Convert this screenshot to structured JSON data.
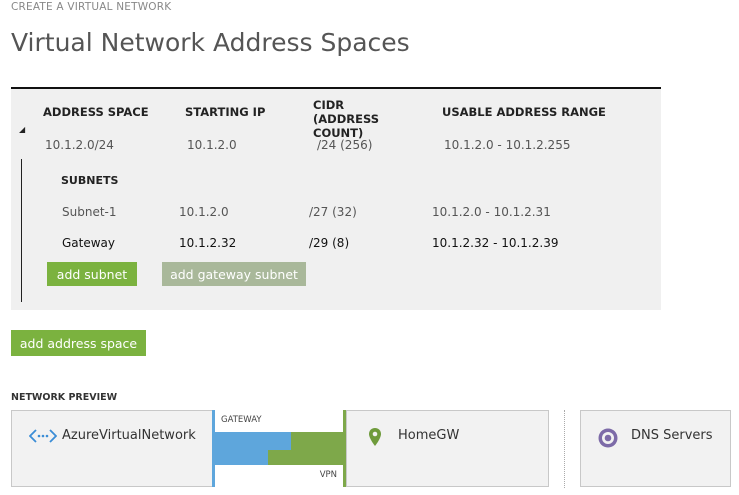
{
  "breadcrumb": "CREATE A VIRTUAL NETWORK",
  "page_title": "Virtual Network Address Spaces",
  "table": {
    "headers": {
      "address_space": "ADDRESS SPACE",
      "starting_ip": "STARTING IP",
      "cidr": "CIDR (ADDRESS COUNT)",
      "usable_range": "USABLE ADDRESS RANGE"
    },
    "address_space_row": {
      "address_space": "10.1.2.0/24",
      "starting_ip": "10.1.2.0",
      "cidr": "/24 (256)",
      "usable_range": "10.1.2.0 - 10.1.2.255"
    },
    "subnets_label": "SUBNETS",
    "subnets": [
      {
        "name": "Subnet-1",
        "starting_ip": "10.1.2.0",
        "cidr": "/27 (32)",
        "usable_range": "10.1.2.0 - 10.1.2.31"
      },
      {
        "name": "Gateway",
        "starting_ip": "10.1.2.32",
        "cidr": "/29 (8)",
        "usable_range": "10.1.2.32 - 10.1.2.39"
      }
    ],
    "add_subnet_label": "add subnet",
    "add_gateway_subnet_label": "add gateway subnet"
  },
  "add_address_space_label": "add address space",
  "preview": {
    "section_label": "NETWORK PREVIEW",
    "vnet_name": "AzureVirtualNetwork",
    "gateway_label": "GATEWAY",
    "vpn_label": "VPN",
    "local_network_name": "HomeGW",
    "dns_label": "DNS Servers"
  },
  "colors": {
    "accent_green": "#7bb23f",
    "disabled_green": "#a9b89a",
    "gateway_blue": "#5ea6dc",
    "vpn_green": "#7ea84a",
    "dns_purple": "#7d6ba8"
  }
}
